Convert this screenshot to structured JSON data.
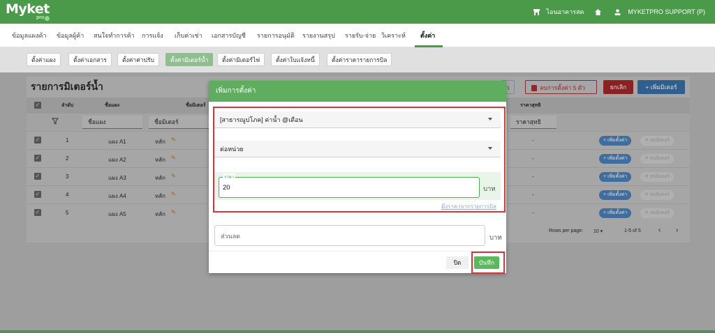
{
  "app": {
    "logo": "Myket",
    "logo_sub": "pro"
  },
  "topbar": {
    "store_label": "ไอนอาคารสด",
    "user_label": "MYKETPRO SUPPORT (P)",
    "store_icon": "store-icon",
    "home_icon": "home-icon",
    "user_icon": "user-icon"
  },
  "menu": {
    "items": [
      "ข้อมูลแผงค้า",
      "ข้อมูลผู้ค้า",
      "สนใจทำการค้า",
      "การแจ้ง",
      "เก็บค่าเช่า",
      "เอกสารบัญชี",
      "รายการอนุมัติ",
      "รายงานสรุป",
      "รายรับ-จ่าย",
      "วิเคราะห์",
      "ตั้งค่า"
    ],
    "active": "ตั้งค่า"
  },
  "subtabs": {
    "items": [
      "ตั้งค่าแผง",
      "ตั้งค่าเอกสาร",
      "ตั้งค่าค่าปรับ",
      "ตั้งค่ามิเตอร์น้ำ",
      "ตั้งค่ามิเตอร์ไฟ",
      "ตั้งค่าใบแจ้งหนี้",
      "ตั้งค่าราคารายการบิล"
    ],
    "active": "ตั้งค่ามิเตอร์น้ำ"
  },
  "page": {
    "title": "รายการมิเตอร์น้ำ",
    "btn_partial": "ว",
    "btn_delete": "ลบการตั้งค่า 5 ตัว",
    "btn_cancel": "ยกเลิก",
    "btn_add_meter": "+ เพิ่มมิเตอร์"
  },
  "table": {
    "headers": [
      "ลำดับ",
      "ชื่อแผง",
      "ชื่อมิเตอร์",
      "ราคาสุทธิ"
    ],
    "filters": {
      "stall": "ชื่อแผง",
      "meter": "ชื่อมิเตอร์",
      "net": "ราคาสุทธิ"
    },
    "rows": [
      {
        "no": "1",
        "stall": "แผง A1",
        "meter": "หลัก",
        "net": "-"
      },
      {
        "no": "2",
        "stall": "แผง A2",
        "meter": "หลัก",
        "net": "-"
      },
      {
        "no": "3",
        "stall": "แผง A3",
        "meter": "หลัก",
        "net": "-"
      },
      {
        "no": "4",
        "stall": "แผง A4",
        "meter": "หลัก",
        "net": "-"
      },
      {
        "no": "5",
        "stall": "แผง A5",
        "meter": "หลัก",
        "net": "-"
      }
    ],
    "row_add": "+ เพิ่มตั้งค่า",
    "row_del": "✕ ลบมิเตอร์"
  },
  "pagination": {
    "label": "Rows per page:",
    "value": "10",
    "range": "1-5 of 5"
  },
  "modal": {
    "title": "เพิ่มการตั้งค่า",
    "select1": "[สาธารณูปโภค] ค่าน้ำ @เดือน",
    "select2": "ต่อหน่วย",
    "price_legend": "ราคา",
    "price_value": "20",
    "unit": "บาท",
    "link": "ดึงราคาจากรายการบิล",
    "discount_placeholder": "ส่วนลด",
    "discount_unit": "บาท",
    "btn_close": "ปิด",
    "btn_save": "บันทึก"
  }
}
